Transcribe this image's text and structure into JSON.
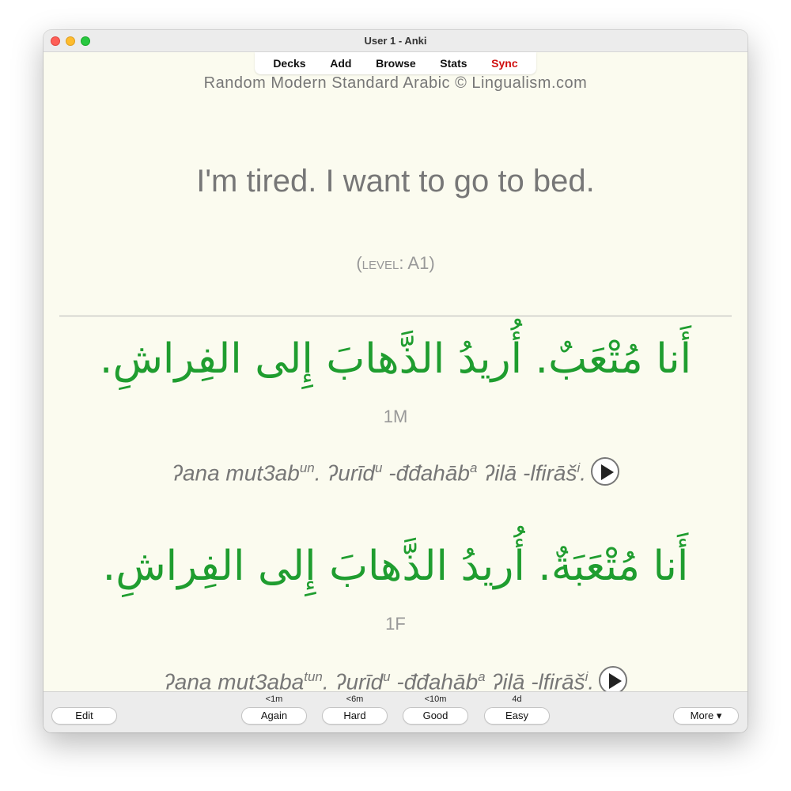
{
  "window": {
    "title": "User 1 - Anki"
  },
  "toolbar": {
    "decks": "Decks",
    "add": "Add",
    "browse": "Browse",
    "stats": "Stats",
    "sync": "Sync",
    "sync_color": "#d01010"
  },
  "card": {
    "deck_title": "Random Modern Standard Arabic © Lingualism.com",
    "front": "I'm tired. I want to go to bed.",
    "level_label": "level",
    "level_value": "A1",
    "masculine": {
      "arabic": "أَنا مُتْعَبٌ. أُريدُ الذَّهابَ إِلى الفِراشِ.",
      "gender": "1M",
      "tl": {
        "p1": "ʔana mut3ab",
        "s1": "un",
        "p2": ". ʔurīd",
        "s2": "u",
        "p3": " -đđahāb",
        "s3": "a",
        "p4": " ʔilā -lfirāš",
        "s4": "i",
        "p5": "."
      }
    },
    "feminine": {
      "arabic": "أَنا مُتْعَبَةٌ. أُريدُ الذَّهابَ إِلى الفِراشِ.",
      "gender": "1F",
      "tl": {
        "p1": "ʔana mut3aba",
        "s1": "tun",
        "p2": ". ʔurīd",
        "s2": "u",
        "p3": " -đđahāb",
        "s3": "a",
        "p4": " ʔilā -lfirāš",
        "s4": "i",
        "p5": "."
      }
    },
    "arabic_color": "#1f9d2f"
  },
  "bottom": {
    "edit": "Edit",
    "again": {
      "label": "Again",
      "time": "<1m"
    },
    "hard": {
      "label": "Hard",
      "time": "<6m"
    },
    "good": {
      "label": "Good",
      "time": "<10m"
    },
    "easy": {
      "label": "Easy",
      "time": "4d"
    },
    "more": "More ▾"
  }
}
